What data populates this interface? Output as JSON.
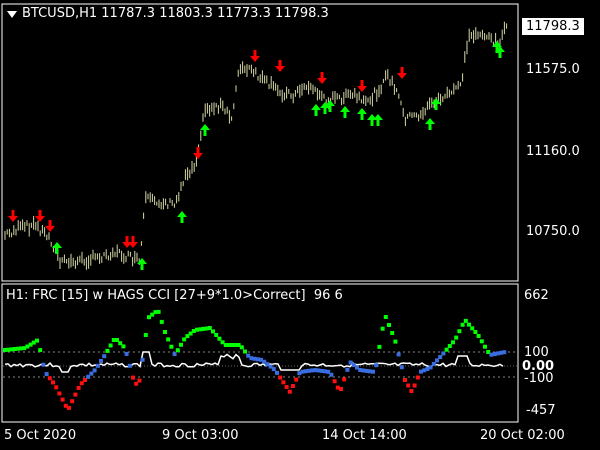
{
  "window": {
    "symbol_tf": "BTCUSD,H1",
    "ohlc": [
      "11787.3",
      "11803.3",
      "11773.3",
      "11798.3"
    ],
    "current_price": "11798.3"
  },
  "price_axis": {
    "labels": [
      "11575.0",
      "11160.0",
      "10750.0"
    ]
  },
  "indicator": {
    "title": "H1: FRC [15] w HAGS CCI [27+9*1.0>Correct]",
    "values": "96 6",
    "axis_labels": [
      "662",
      "100",
      "0.00",
      "-100",
      "-457"
    ]
  },
  "time_axis": {
    "labels": [
      "5 Oct 2020",
      "9 Oct 03:00",
      "14 Oct 14:00",
      "20 Oct 02:00"
    ]
  },
  "colors": {
    "up_arrow": "#00ff00",
    "down_arrow": "#ff0000",
    "cci_green": "#00ff00",
    "cci_blue": "#3a6ee0",
    "cci_red": "#ff1010",
    "signal_line": "#ffffff",
    "candles": "#d8d8a8"
  },
  "icons": {
    "dropdown": "triangle-down-icon",
    "up_signal": "green-up-arrow-icon",
    "down_signal": "red-down-arrow-icon"
  }
}
